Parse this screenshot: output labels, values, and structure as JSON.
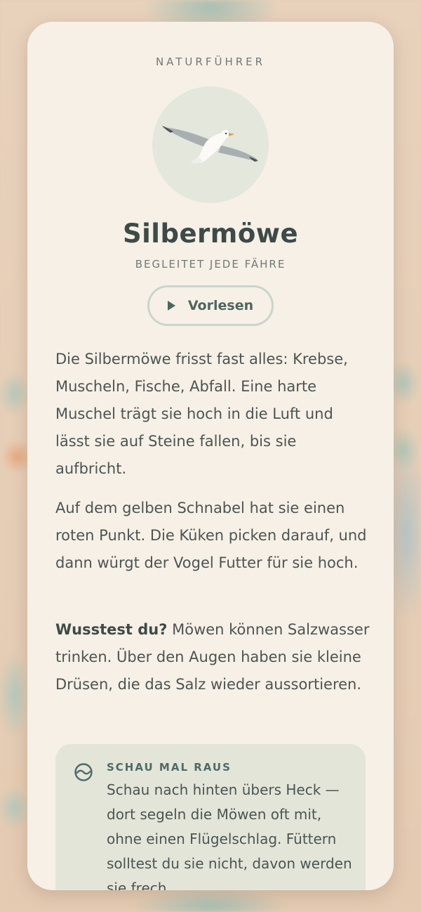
{
  "section_label": "NATURFÜHRER",
  "animal": {
    "name": "Silbermöwe",
    "tagline": "BEGLEITET JEDE FÄHRE",
    "illustration_icon": "gull-in-flight-icon"
  },
  "read_aloud": {
    "label": "Vorlesen",
    "icon": "play-icon"
  },
  "paragraphs": [
    "Die Silbermöwe frisst fast alles: Krebse, Muscheln, Fische, Abfall. Eine harte Muschel trägt sie hoch in die Luft und lässt sie auf Steine fallen, bis sie aufbricht.",
    "Auf dem gelben Schnabel hat sie einen roten Punkt. Die Küken picken darauf, und dann würgt der Vogel Futter für sie hoch."
  ],
  "fun_fact": {
    "lead": "Wusstest du?",
    "text": " Möwen können Salzwasser trinken. Über den Augen haben sie kleine Drüsen, die das Salz wieder aussortieren."
  },
  "tip": {
    "icon": "eye-icon",
    "label": "SCHAU MAL RAUS",
    "text": "Schau nach hinten übers Heck — dort segeln die Möwen oft mit, ohne einen Flügelschlag. Füttern solltest du sie nicht, davon werden sie frech."
  },
  "colors": {
    "page_background": "#e6cdb4",
    "card": "#f7f0e6",
    "accent": "#4d6661",
    "tip_background": "#e3e5d9"
  }
}
